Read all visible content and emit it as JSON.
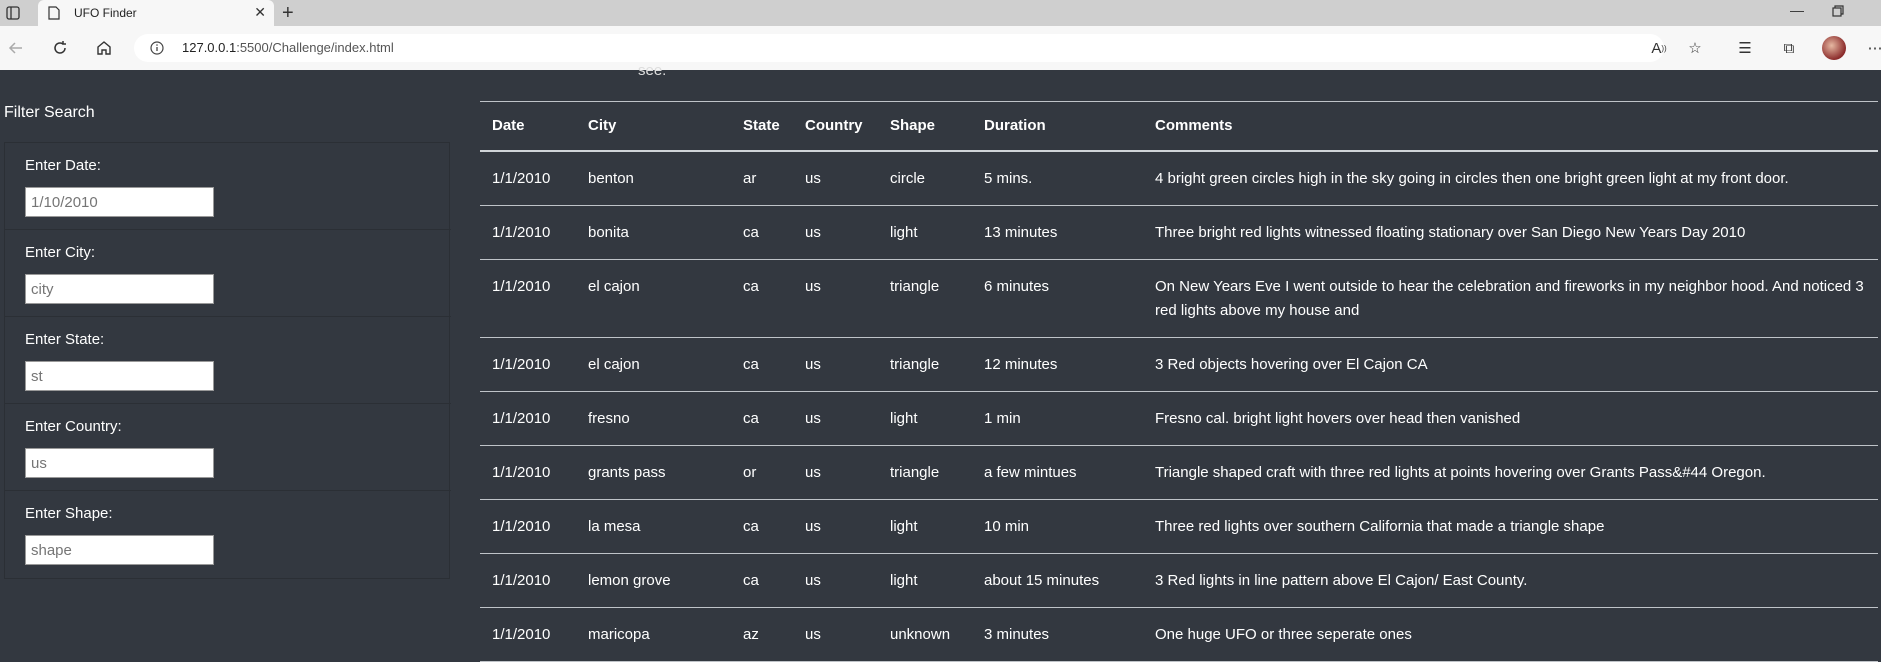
{
  "browser": {
    "tab_title": "UFO Finder",
    "url_host": "127.0.0.1",
    "url_path": ":5500/Challenge/index.html"
  },
  "page": {
    "cut_text": "see.",
    "filter": {
      "title": "Filter Search",
      "fields": [
        {
          "label": "Enter Date:",
          "placeholder": "1/10/2010"
        },
        {
          "label": "Enter City:",
          "placeholder": "city"
        },
        {
          "label": "Enter State:",
          "placeholder": "st"
        },
        {
          "label": "Enter Country:",
          "placeholder": "us"
        },
        {
          "label": "Enter Shape:",
          "placeholder": "shape"
        }
      ]
    },
    "table": {
      "headers": [
        "Date",
        "City",
        "State",
        "Country",
        "Shape",
        "Duration",
        "Comments"
      ],
      "rows": [
        [
          "1/1/2010",
          "benton",
          "ar",
          "us",
          "circle",
          "5 mins.",
          "4 bright green circles high in the sky going in circles then one bright green light at my front door."
        ],
        [
          "1/1/2010",
          "bonita",
          "ca",
          "us",
          "light",
          "13 minutes",
          "Three bright red lights witnessed floating stationary over San Diego New Years Day 2010"
        ],
        [
          "1/1/2010",
          "el cajon",
          "ca",
          "us",
          "triangle",
          "6 minutes",
          "On New Years Eve I went outside to hear the celebration and fireworks in my neighbor hood. And noticed 3 red lights above my house and"
        ],
        [
          "1/1/2010",
          "el cajon",
          "ca",
          "us",
          "triangle",
          "12 minutes",
          "3 Red objects hovering over El Cajon CA"
        ],
        [
          "1/1/2010",
          "fresno",
          "ca",
          "us",
          "light",
          "1 min",
          "Fresno cal. bright light hovers over head then vanished"
        ],
        [
          "1/1/2010",
          "grants pass",
          "or",
          "us",
          "triangle",
          "a few mintues",
          "Triangle shaped craft with three red lights at points hovering over Grants Pass&#44 Oregon."
        ],
        [
          "1/1/2010",
          "la mesa",
          "ca",
          "us",
          "light",
          "10 min",
          "Three red lights over southern California that made a triangle shape"
        ],
        [
          "1/1/2010",
          "lemon grove",
          "ca",
          "us",
          "light",
          "about 15 minutes",
          "3 Red lights in line pattern above El Cajon/ East County."
        ],
        [
          "1/1/2010",
          "maricopa",
          "az",
          "us",
          "unknown",
          "3 minutes",
          "One huge UFO or three seperate ones"
        ]
      ]
    }
  }
}
